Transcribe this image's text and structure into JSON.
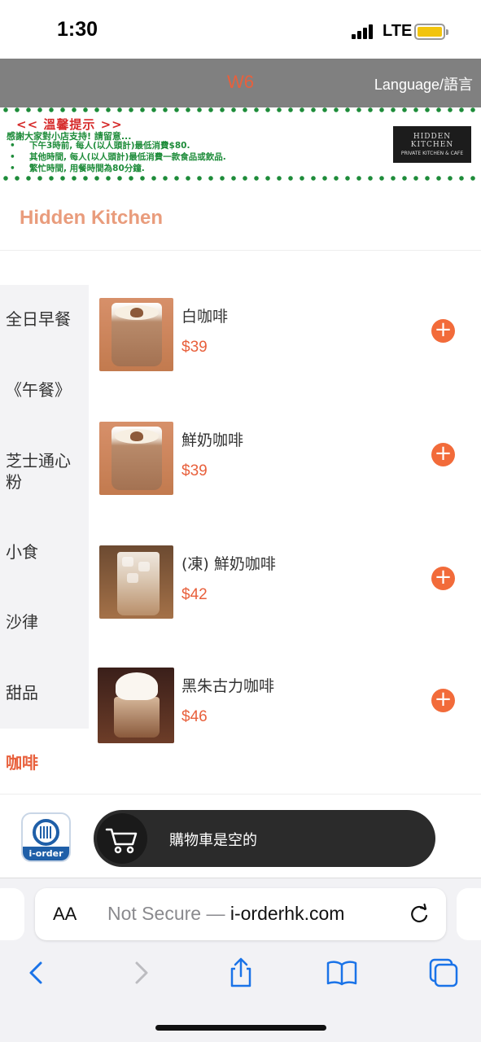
{
  "status_bar": {
    "time": "1:30",
    "network": "LTE",
    "battery_level": 0.85,
    "battery_color": "#f2c40d"
  },
  "header": {
    "store_code": "W6",
    "language_label": "Language/語言",
    "background": "#808080"
  },
  "notice": {
    "title": "<< 溫馨提示 >>",
    "intro": "感謝大家對小店支持! 請留意...",
    "items": [
      "下午3時前, 每人(以人頭計)最低消費$80.",
      "其他時間, 每人(以人頭計)最低消費一款食品或飲品.",
      "繁忙時間, 用餐時間為80分鐘."
    ],
    "logo_line1": "HIDDEN KITCHEN",
    "logo_line2": "PRIVATE KITCHEN & CAFE"
  },
  "restaurant": {
    "name": "Hidden Kitchen"
  },
  "categories": [
    {
      "label": "全日早餐",
      "active": false
    },
    {
      "label": "《午餐》",
      "active": false
    },
    {
      "label": "芝士通心粉",
      "active": false
    },
    {
      "label": "小食",
      "active": false
    },
    {
      "label": "沙律",
      "active": false
    },
    {
      "label": "甜品",
      "active": false
    },
    {
      "label": "咖啡",
      "active": true
    }
  ],
  "products": [
    {
      "name": "白咖啡",
      "price": "$39",
      "image": "latte-icon"
    },
    {
      "name": "鮮奶咖啡",
      "price": "$39",
      "image": "latte-icon"
    },
    {
      "name": "(凍) 鮮奶咖啡",
      "price": "$42",
      "image": "iced-coffee-icon"
    },
    {
      "name": "黑朱古力咖啡",
      "price": "$46",
      "image": "mocha-icon"
    }
  ],
  "cart": {
    "empty_text": "購物車是空的",
    "logo_text": "i-order"
  },
  "browser": {
    "aa_label": "AA",
    "not_secure": "Not Secure —",
    "domain": "i-orderhk.com"
  },
  "colors": {
    "accent": "#e8603c",
    "add_button": "#f26b3a",
    "notice_green": "#1e8c3a",
    "notice_red": "#d62b2b"
  }
}
